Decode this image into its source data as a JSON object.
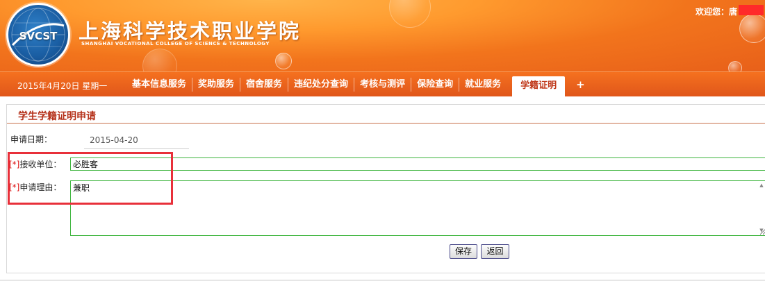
{
  "header": {
    "logo_text": "SVCST",
    "school_name": "上海科学技术职业学院",
    "school_name_en": "SHANGHAI VOCATIONAL COLLEGE OF SCIENCE & TECHNOLOGY",
    "welcome": "欢迎您：唐"
  },
  "nav": {
    "date": "2015年4月20日  星期一",
    "items": [
      {
        "label": "基本信息服务"
      },
      {
        "label": "奖助服务"
      },
      {
        "label": "宿舍服务"
      },
      {
        "label": "违纪处分查询"
      },
      {
        "label": "考核与测评"
      },
      {
        "label": "保险查询"
      },
      {
        "label": "就业服务"
      },
      {
        "label": "学籍证明",
        "active": true
      }
    ],
    "plus": "+"
  },
  "form": {
    "title": "学生学籍证明申请",
    "date_label": "申请日期：",
    "date_value": "2015-04-20",
    "required_mark": "[*]",
    "unit_label": "接收单位：",
    "unit_value": "必胜客",
    "reason_label": "申请理由：",
    "reason_value": "兼职",
    "save_label": "保存",
    "back_label": "返回"
  },
  "colors": {
    "header_orange": "#f2741c",
    "title_red": "#b5311a",
    "input_border_green": "#3cb43c",
    "highlight_red": "#e8303a"
  }
}
